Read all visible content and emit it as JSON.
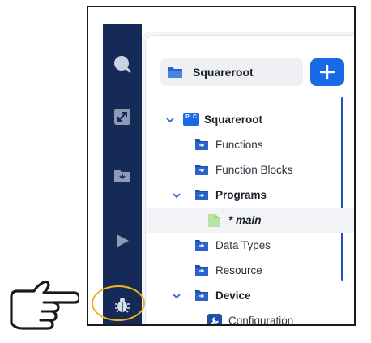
{
  "project": {
    "name": "Squareroot",
    "add_label": "+"
  },
  "tree": [
    {
      "label": "Squareroot",
      "badge": "PLC",
      "icon": "plc-icon",
      "expanded": true,
      "bold": true
    },
    {
      "label": "Functions",
      "icon": "functions-folder-icon"
    },
    {
      "label": "Function Blocks",
      "icon": "function-blocks-folder-icon"
    },
    {
      "label": "Programs",
      "icon": "programs-folder-icon",
      "expanded": true,
      "bold": true
    },
    {
      "label": "* main",
      "icon": "program-file-icon",
      "italic": true,
      "selected": true
    },
    {
      "label": "Data Types",
      "icon": "data-types-folder-icon"
    },
    {
      "label": "Resource",
      "icon": "resource-folder-icon"
    },
    {
      "label": "Device",
      "icon": "device-folder-icon",
      "expanded": true,
      "bold": true
    },
    {
      "label": "Configuration",
      "icon": "wrench-icon"
    }
  ],
  "sidebar": [
    {
      "icon": "search-icon"
    },
    {
      "icon": "expand-icon"
    },
    {
      "icon": "download-folder-icon"
    },
    {
      "icon": "run-icon"
    },
    {
      "icon": "debug-bug-icon",
      "highlighted": true
    }
  ],
  "annotation": {
    "pointer_icon": "pointing-hand-icon",
    "highlight_color": "#f2b21b"
  },
  "colors": {
    "sidebar": "#152a57",
    "accent": "#1769e6"
  }
}
